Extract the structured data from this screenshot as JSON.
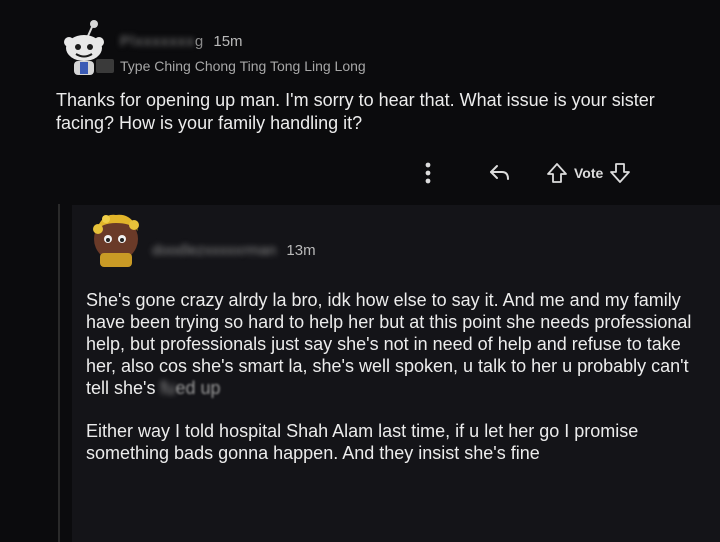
{
  "comment1": {
    "username_visible_start": "Pl",
    "username_hidden": "xxxxxxx",
    "username_visible_end": "g",
    "time": "15m",
    "flair": "Type Ching Chong Ting Tong Ling Long",
    "body": "Thanks for opening up man. I'm sorry to hear that. What issue is your sister facing? How is your family handling it?",
    "actions": {
      "more_icon": "more-vertical-icon",
      "reply_icon": "reply-arrow-icon",
      "upvote_icon": "arrow-up-icon",
      "vote_label": "Vote",
      "downvote_icon": "arrow-down-icon"
    }
  },
  "comment2": {
    "username_visible_start": "dood",
    "username_hidden": "lezxxxxx",
    "username_visible_end": "rman",
    "time": "13m",
    "paragraph1_a": "She's gone crazy alrdy la bro, idk how else to say it. And me and my family have been trying so hard to help her but at this point she needs professional help, but professionals just say she's not in need of help and refuse to take her, also cos she's smart la, she's well spoken, u talk to her u probably can't tell she's ",
    "paragraph1_blur": "fu",
    "paragraph1_b": "ed up",
    "paragraph2": "Either way I told hospital Shah Alam last time, if u let her go I promise something bads gonna happen. And they insist she's fine"
  },
  "colors": {
    "background": "#0b0b0d",
    "reply_panel": "#141418",
    "text": "#ececec",
    "meta": "#b9b9b9"
  }
}
